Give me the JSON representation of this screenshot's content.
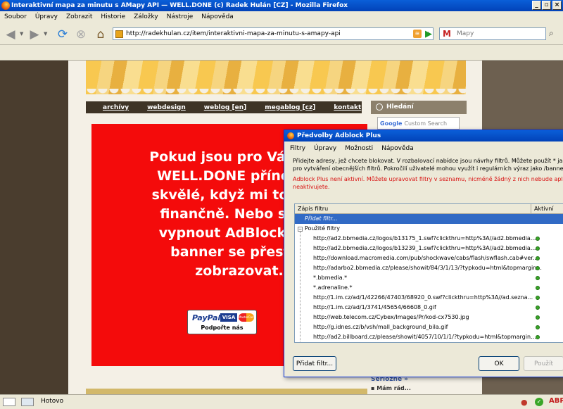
{
  "window": {
    "title": "Interaktivní mapa za minutu s AMapy API — WELL.DONE (c) Radek Hulán [CZ] - Mozilla Firefox"
  },
  "menu": [
    "Soubor",
    "Úpravy",
    "Zobrazit",
    "Historie",
    "Záložky",
    "Nástroje",
    "Nápověda"
  ],
  "address": {
    "url": "http://radekhulan.cz/item/interaktivni-mapa-za-minutu-s-amapy-api"
  },
  "search": {
    "placeholder": "Mapy"
  },
  "site": {
    "nav": [
      "archívy",
      "webdesign",
      "weblog [en]",
      "megablog [cz]",
      "kontakt"
    ],
    "ad_text": "Pokud jsou pro Vás člán\nWELL.DONE přínosné,\nskvělé, když mi to dáte\nfinančně. Nebo si mů\nvypnout AdBlock a te\nbanner se přestan\nzobrazovat.",
    "paypal_logo": "PayPal",
    "card_visa": "VISA",
    "card_mc": "MasterCard",
    "paypal_label": "Podpořte nás",
    "search_title": "Hledání",
    "google_placeholder": "Custom Search",
    "sidebar_link1": "Seriózně »",
    "sidebar_link2": "▪ Mám rád..."
  },
  "dialog": {
    "title": "Předvolby Adblock Plus",
    "menu": [
      "Filtry",
      "Úpravy",
      "Možnosti",
      "Nápověda"
    ],
    "desc": "Přidejte adresy, jež chcete blokovat. V rozbalovací nabídce jsou návrhy filtrů. Můžete použít * jako \"di\npro vytváření obecnějších filtrů. Pokročilí uživatelé mohou využít i regulárních výraz jako /banner\\d+\\",
    "warn": "Adblock Plus není aktivní. Můžete upravovat filtry v seznamu, nicméně žádný z nich nebude aplikován,\nneaktivujete.",
    "col_filter": "Zápis filtru",
    "col_active": "Aktivní",
    "add_row": "Přidat filtr...",
    "group": "Použité filtry",
    "filters": [
      "http://ad2.bbmedia.cz/logos/b13175_1.swf?clickthru=http%3A//ad2.bbmedia...",
      "http://ad2.bbmedia.cz/logos/b13239_1.swf?clickthru=http%3A//ad2.bbmedia...",
      "http://download.macromedia.com/pub/shockwave/cabs/flash/swflash.cab#ver...",
      "http://adarbo2.bbmedia.cz/please/showit/84/3/1/13/?typkodu=html&topmargin...",
      "*.bbmedia.*",
      "*.adrenaline.*",
      "http://1.im.cz/ad/1/42266/47403/68920_0.swf?clickthru=http%3A//ad.sezna...",
      "http://1.im.cz/ad/1/3741/45654/66608_0.gif",
      "http://web.telecom.cz/Cybex/Images/Pr/kod-cx7530.jpg",
      "http://g.idnes.cz/b/vsh/mall_background_bila.gif",
      "http://ad2.billboard.cz/please/showit/4057/10/1/1/?typkodu=html&topmargin..."
    ],
    "btn_add": "Přidat filtr...",
    "btn_ok": "OK",
    "btn_apply": "Použít"
  },
  "status": {
    "text": "Hotovo"
  }
}
